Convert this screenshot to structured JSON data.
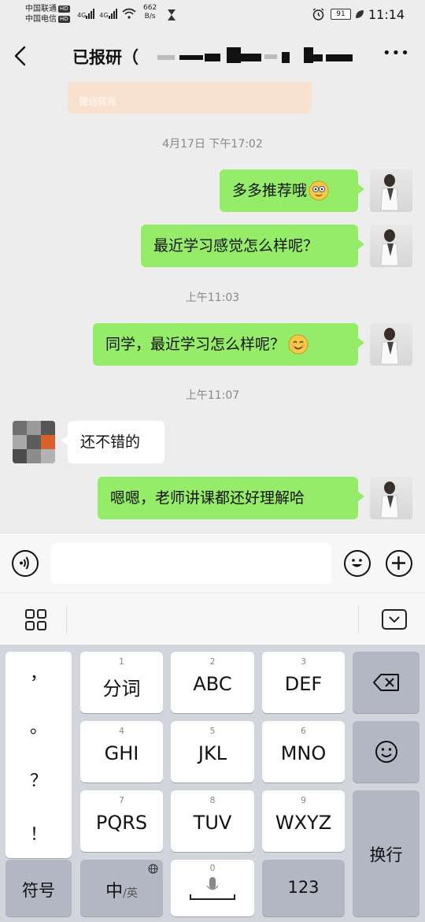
{
  "status_bar": {
    "carrier1": "中国联通",
    "carrier2": "中国电信",
    "hd": "HD",
    "net_4g": "4G",
    "net_speed_value": "662",
    "net_speed_unit": "B/s",
    "battery": "91",
    "time": "11:14"
  },
  "header": {
    "title": "已报研（",
    "back_icon": "chevron-left-icon",
    "more_label": "•••"
  },
  "chat": {
    "faded_card_text": "微信转账",
    "messages": [
      {
        "type": "timestamp",
        "text": "4月17日 下午17:02"
      },
      {
        "type": "sent",
        "text": "多多推荐哦"
      },
      {
        "type": "sent",
        "text": "最近学习感觉怎么样呢？"
      },
      {
        "type": "timestamp",
        "text": "上午11:03"
      },
      {
        "type": "sent",
        "text": "同学，最近学习怎么样呢？"
      },
      {
        "type": "timestamp",
        "text": "上午11:07"
      },
      {
        "type": "received",
        "text": "还不错的"
      },
      {
        "type": "sent",
        "text": "嗯嗯，老师讲课都还好理解哈"
      }
    ]
  },
  "input_bar": {
    "input_value": "",
    "voice_icon": "voice-icon",
    "emoji_icon": "emoji-icon",
    "plus_icon": "plus-icon"
  },
  "ime_toolbar": {
    "apps_icon": "grid-icon",
    "collapse_icon": "keyboard-collapse-icon"
  },
  "keyboard": {
    "punctuation": [
      "，",
      "。",
      "？",
      "！"
    ],
    "keys": [
      {
        "num": "1",
        "label": "分词"
      },
      {
        "num": "2",
        "label": "ABC"
      },
      {
        "num": "3",
        "label": "DEF"
      },
      {
        "num": "4",
        "label": "GHI"
      },
      {
        "num": "5",
        "label": "JKL"
      },
      {
        "num": "6",
        "label": "MNO"
      },
      {
        "num": "7",
        "label": "PQRS"
      },
      {
        "num": "8",
        "label": "TUV"
      },
      {
        "num": "9",
        "label": "WXYZ"
      }
    ],
    "symbol_label": "符号",
    "lang_main": "中",
    "lang_alt": "/英",
    "space_num": "0",
    "num_label": "123",
    "enter_label": "换行"
  }
}
